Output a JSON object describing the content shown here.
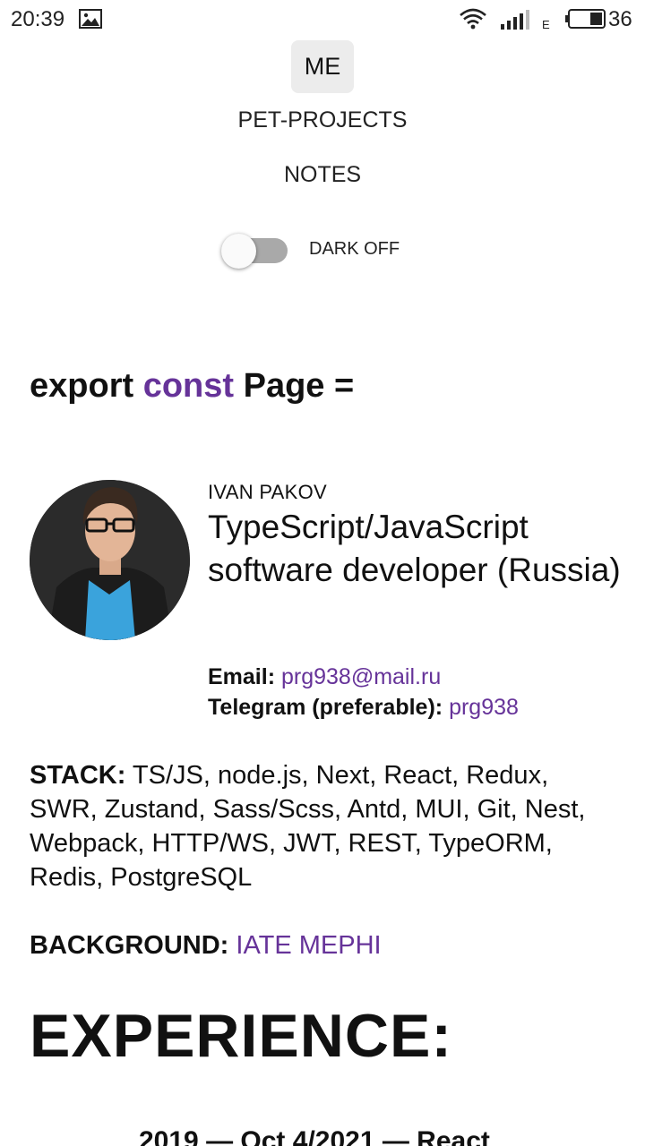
{
  "status_bar": {
    "time": "20:39",
    "network_type": "E",
    "battery": "36",
    "icons": [
      "gallery-icon",
      "wifi-icon",
      "signal-icon",
      "battery-icon"
    ]
  },
  "nav": {
    "items": [
      {
        "label": "ME",
        "active": true
      },
      {
        "label": "PET-PROJECTS",
        "active": false
      },
      {
        "label": "NOTES",
        "active": false
      }
    ]
  },
  "theme_toggle": {
    "label": "DARK OFF",
    "on": false
  },
  "code_heading": {
    "part1": "export ",
    "keyword": "const",
    "part2": " Page ="
  },
  "profile": {
    "name": "IVAN PAKOV",
    "role": "TypeScript/JavaScript software developer (Russia)",
    "email_label": "Email:",
    "email": "prg938@mail.ru",
    "telegram_label": "Telegram (preferable):",
    "telegram": "prg938"
  },
  "stack": {
    "label": "STACK:",
    "value": " TS/JS, node.js, Next, React, Redux, SWR, Zustand, Sass/Scss, Antd, MUI, Git, Nest, Webpack, HTTP/WS, JWT, REST, TypeORM, Redis, PostgreSQL"
  },
  "background": {
    "label": "BACKGROUND:",
    "value": "IATE MEPHI"
  },
  "experience": {
    "heading": "EXPERIENCE:",
    "first_job": "2019 — Oct 4/2021 — React"
  },
  "colors": {
    "accent": "#663399",
    "toggle_track": "#a9a9a9",
    "nav_active_bg": "#ececec"
  }
}
